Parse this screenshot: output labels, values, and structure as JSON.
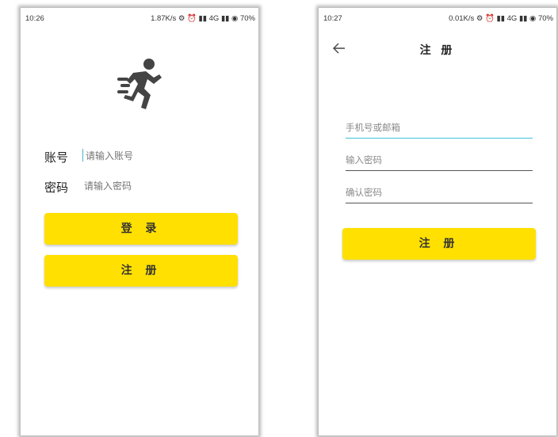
{
  "login": {
    "status_time": "10:26",
    "status_right": "1.87K/s ⚙ ⏰ ▮▮ 4G ▮▮ ◉ 70%",
    "account_label": "账号",
    "account_placeholder": "请输入账号",
    "password_label": "密码",
    "password_placeholder": "请输入密码",
    "login_button": "登 录",
    "register_button": "注 册"
  },
  "register": {
    "status_time": "10:27",
    "status_right": "0.01K/s ⚙ ⏰ ▮▮ 4G ▮▮ ◉ 70%",
    "title": "注 册",
    "phone_email_placeholder": "手机号或邮箱",
    "password_placeholder": "输入密码",
    "confirm_password_placeholder": "确认密码",
    "register_button": "注 册"
  },
  "icons": {
    "logo": "running-person-icon",
    "back": "back-arrow-icon"
  },
  "colors": {
    "accent": "#ffe000",
    "focus_line": "#40c4d8"
  }
}
